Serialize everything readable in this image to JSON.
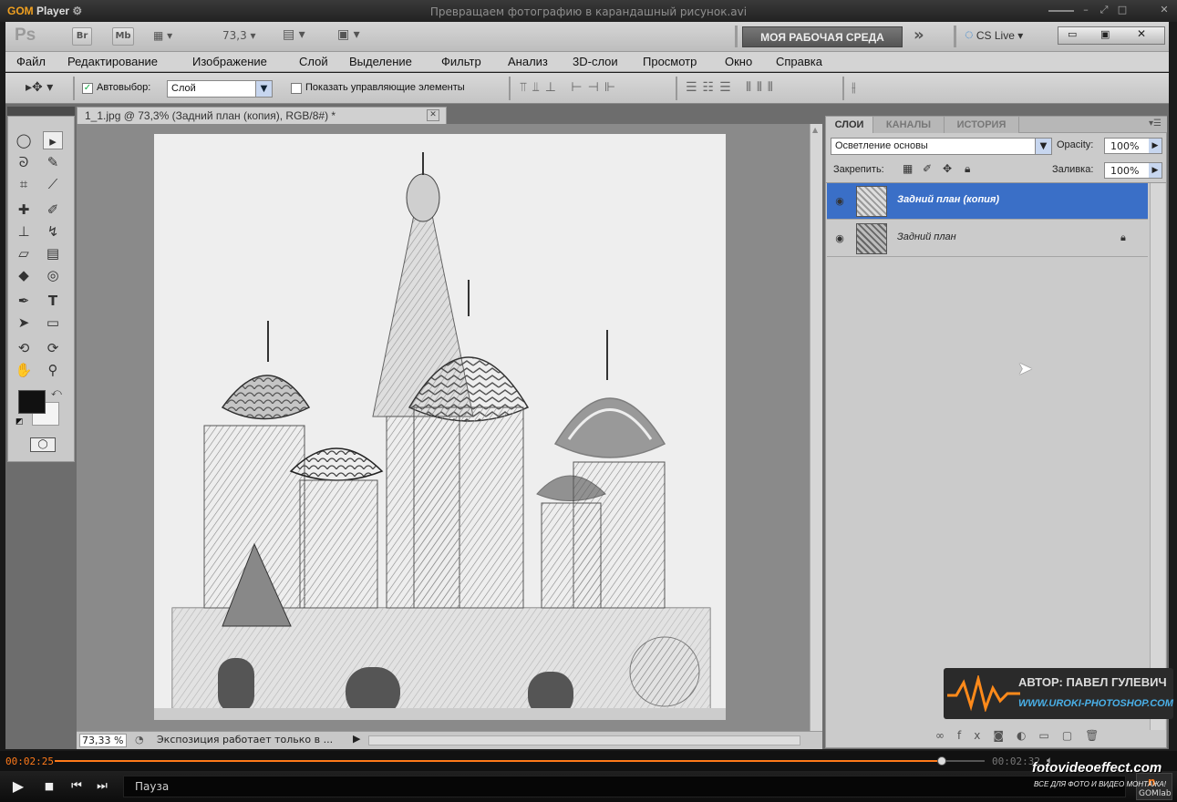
{
  "gom": {
    "logo_gom": "GOM",
    "logo_player": "Player",
    "title": "Превращаем фотографию в карандашный рисунок.avi",
    "time_current": "00:02:25",
    "time_total": "00:02:32",
    "status": "Пауза",
    "progress": 0.954,
    "badge": "GOMlab",
    "watermark_site": "fotovideoeffect.com",
    "watermark_slogan": "ВСЕ ДЛЯ ФОТО И ВИДЕО МОНТАЖА!"
  },
  "ps": {
    "logo": "Ps",
    "btn_br": "Br",
    "btn_mb": "Mb",
    "zoom_value": "73,3",
    "workspace": "МОЯ РАБОЧАЯ СРЕДА",
    "cs_live": "CS Live",
    "menu": [
      "Файл",
      "Редактирование",
      "Изображение",
      "Слой",
      "Выделение",
      "Фильтр",
      "Анализ",
      "3D-слои",
      "Просмотр",
      "Окно",
      "Справка"
    ],
    "options": {
      "autoselect_label": "Автовыбор:",
      "autoselect_value": "Слой",
      "show_controls_label": "Показать управляющие элементы"
    },
    "document": {
      "tab_title": "1_1.jpg @ 73,3% (Задний план (копия), RGB/8#) *",
      "zoom_status": "73,33 %",
      "status_text": "Экспозиция работает только в ..."
    },
    "panel": {
      "tabs": [
        "СЛОИ",
        "КАНАЛЫ",
        "ИСТОРИЯ"
      ],
      "blend_mode": "Осветление основы",
      "opacity_label": "Opacity:",
      "opacity_value": "100%",
      "lock_label": "Закрепить:",
      "fill_label": "Заливка:",
      "fill_value": "100%",
      "layers": [
        {
          "name": "Задний план (копия)",
          "selected": true
        },
        {
          "name": "Задний план",
          "selected": false
        }
      ]
    },
    "watermark": {
      "author": "АВТОР: ПАВЕЛ ГУЛЕВИЧ",
      "site": "WWW.UROKI-PHOTOSHOP.COM"
    }
  },
  "colors": {
    "accent_orange": "#ff7a1a",
    "layer_selected": "#3a6fc7",
    "ps_chrome": "#c9c9c9"
  }
}
